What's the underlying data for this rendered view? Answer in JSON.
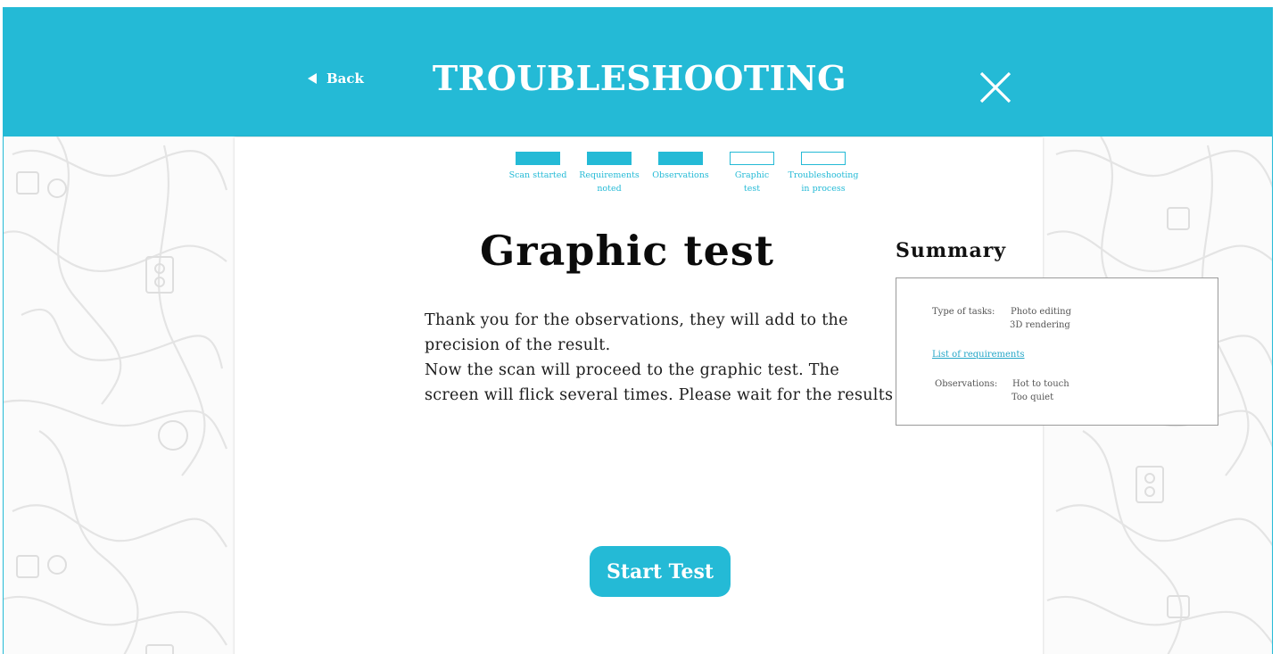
{
  "header": {
    "back_label": "Back",
    "title": "TROUBLESHOOTING"
  },
  "steps": [
    {
      "label_1": "Scan sttarted",
      "label_2": "",
      "complete": true
    },
    {
      "label_1": "Requirements",
      "label_2": "noted",
      "complete": true
    },
    {
      "label_1": "Observations",
      "label_2": "",
      "complete": true
    },
    {
      "label_1": "Graphic",
      "label_2": "test",
      "complete": false
    },
    {
      "label_1": "Troubleshooting",
      "label_2": "in process",
      "complete": false
    }
  ],
  "main": {
    "heading": "Graphic test",
    "message_line_1": "Thank you for the observations, they will add to the precision of the result.",
    "message_line_2": "Now the scan will proceed to the graphic test. The screen will flick several times.  Please wait for the results",
    "start_button": "Start Test"
  },
  "summary": {
    "title": "Summary",
    "type_of_tasks_label": "Type of tasks:",
    "type_of_tasks_values": [
      "Photo editing",
      "3D rendering"
    ],
    "requirements_link": "List of requirements",
    "observations_label": "Observations:",
    "observations_values": [
      "Hot to touch",
      "Too quiet"
    ]
  },
  "colors": {
    "accent": "#24bad6",
    "background_pattern": "#e6e6e6",
    "text": "#1c1c1c"
  },
  "icons": {
    "back": "triangle-left-icon",
    "close": "close-icon"
  }
}
